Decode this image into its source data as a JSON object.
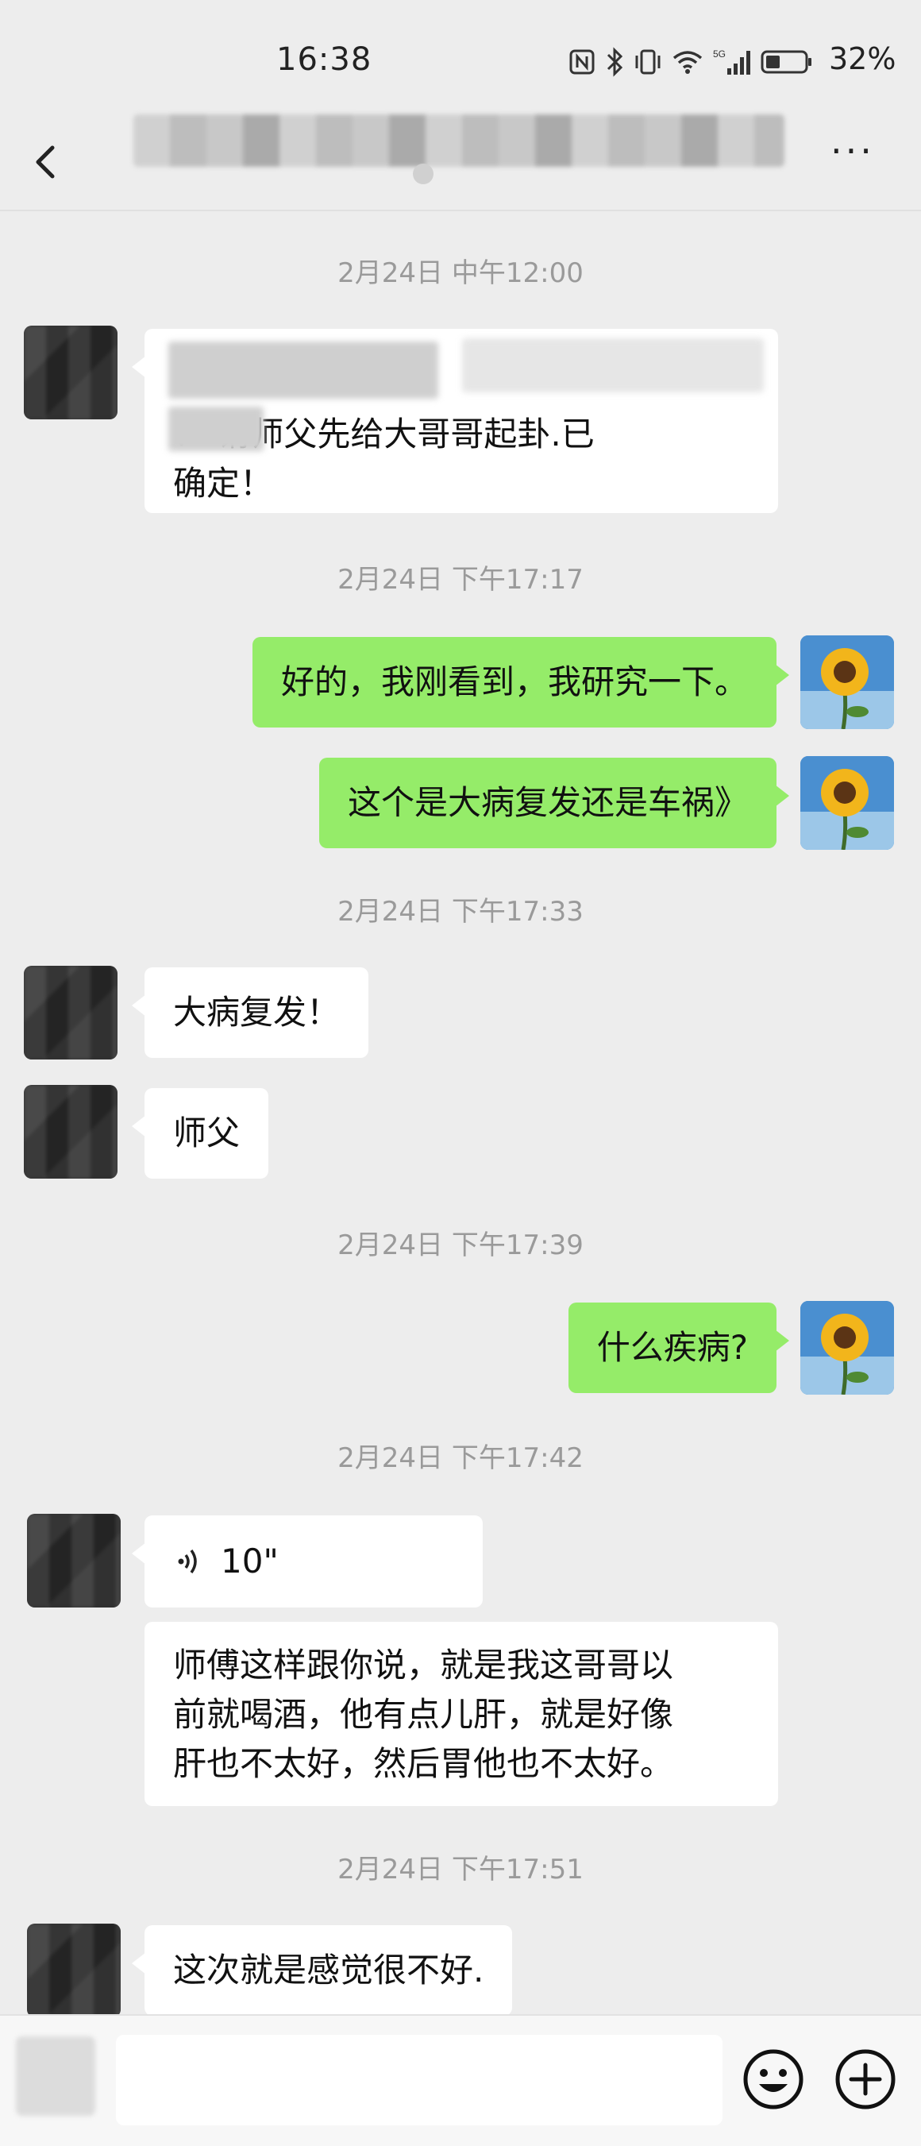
{
  "status_bar": {
    "time": "16:38",
    "battery_percent": "32%",
    "icons": [
      "nfc-icon",
      "bluetooth-icon",
      "vibrate-icon",
      "wifi-icon",
      "signal-5g-icon",
      "battery-icon"
    ],
    "network_label": "5G"
  },
  "header": {
    "title": "",
    "subtitle": "",
    "back_icon": "chevron-left-icon",
    "more_icon": "more-horizontal-icon",
    "more_label": "···"
  },
  "chat": {
    "ts1": "2月24日 中午12:00",
    "msg1_line2": "！  请师父先给大哥哥起卦.已",
    "msg1_line3": "确定！",
    "ts2": "2月24日 下午17:17",
    "msg2": "好的，我刚看到，我研究一下。",
    "msg3": "这个是大病复发还是车祸》",
    "ts3": "2月24日 下午17:33",
    "msg4": "大病复发！",
    "msg5": "师父",
    "ts4": "2月24日 下午17:39",
    "msg6": "什么疾病?",
    "ts5": "2月24日 下午17:42",
    "voice_duration": "10\"",
    "msg7_line1": "师傅这样跟你说，就是我这哥哥以",
    "msg7_line2": "前就喝酒，他有点儿肝，就是好像",
    "msg7_line3": "肝也不太好，然后胃他也不太好。",
    "ts6": "2月24日 下午17:51",
    "msg8": "这次就是感觉很不好."
  },
  "input_bar": {
    "text_value": "",
    "emoji_icon": "emoji-smile-icon",
    "plus_icon": "plus-circle-icon"
  },
  "colors": {
    "background": "#ededed",
    "bubble_self": "#95ec69",
    "bubble_other": "#ffffff",
    "timestamp": "#9a9a9a"
  }
}
